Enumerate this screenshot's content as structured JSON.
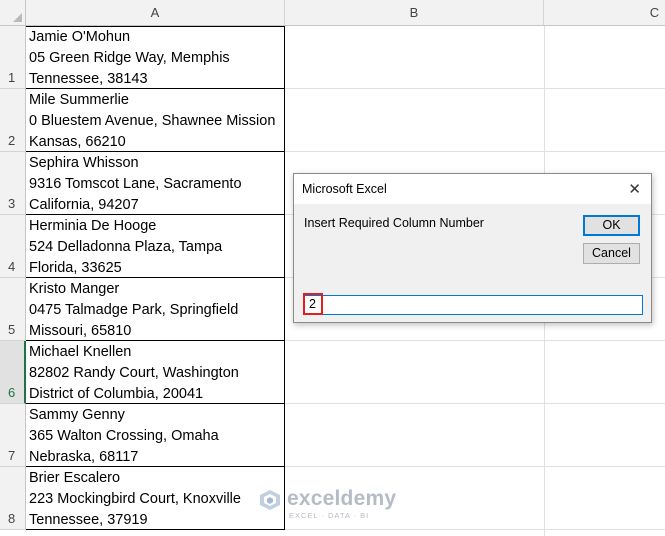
{
  "columns": [
    "A",
    "B",
    "C"
  ],
  "rows": [
    {
      "num": "1",
      "lines": [
        "Jamie O'Mohun",
        "05 Green Ridge Way, Memphis",
        "Tennessee, 38143"
      ]
    },
    {
      "num": "2",
      "lines": [
        "Mile Summerlie",
        "0 Bluestem Avenue, Shawnee Mission",
        "Kansas, 66210"
      ]
    },
    {
      "num": "3",
      "lines": [
        "Sephira Whisson",
        "9316 Tomscot Lane, Sacramento",
        "California, 94207"
      ]
    },
    {
      "num": "4",
      "lines": [
        "Herminia De Hooge",
        "524 Delladonna Plaza, Tampa",
        "Florida, 33625"
      ]
    },
    {
      "num": "5",
      "lines": [
        "Kristo Manger",
        "0475 Talmadge Park, Springfield",
        "Missouri, 65810"
      ]
    },
    {
      "num": "6",
      "lines": [
        "Michael Knellen",
        "82802 Randy Court, Washington",
        "District of Columbia, 20041"
      ]
    },
    {
      "num": "7",
      "lines": [
        "Sammy Genny",
        "365 Walton Crossing, Omaha",
        "Nebraska, 68117"
      ]
    },
    {
      "num": "8",
      "lines": [
        "Brier Escalero",
        "223 Mockingbird Court, Knoxville",
        "Tennessee, 37919"
      ]
    }
  ],
  "active_row": "6",
  "dialog": {
    "title": "Microsoft Excel",
    "close_glyph": "✕",
    "prompt": "Insert Required Column Number",
    "ok_label": "OK",
    "cancel_label": "Cancel",
    "input_value": "2"
  },
  "watermark": {
    "name": "exceldemy",
    "tagline": "EXCEL · DATA · BI"
  },
  "colors": {
    "accent": "#217346",
    "focus": "#0078d7",
    "highlight": "#e41e1e"
  }
}
